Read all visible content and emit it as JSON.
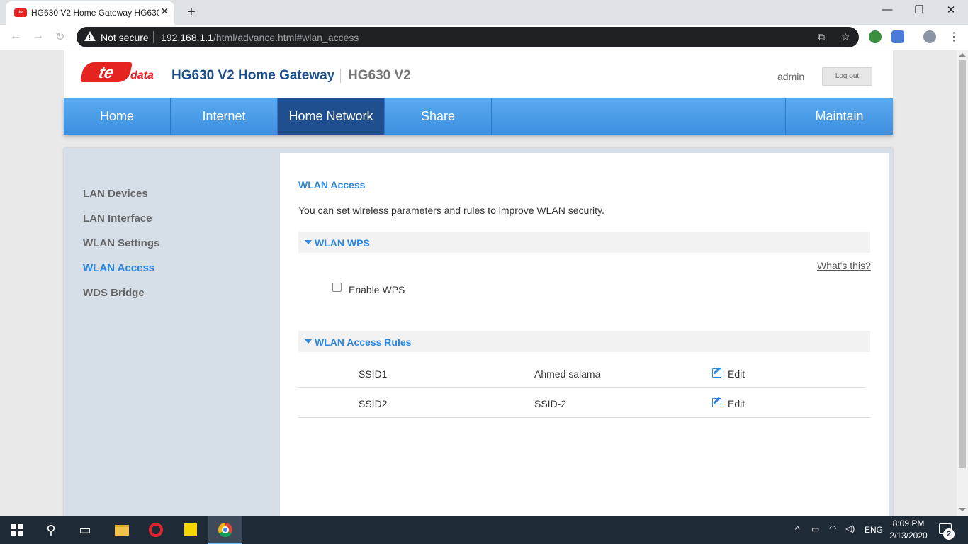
{
  "browser": {
    "tab_title": "HG630 V2 Home Gateway HG630 V2",
    "tab_close": "✕",
    "new_tab": "+",
    "security_label": "Not secure",
    "url_host": "192.168.1.1",
    "url_path": "/html/advance.html#wlan_access",
    "window_controls": {
      "minimize": "—",
      "restore": "❐",
      "close": "✕"
    }
  },
  "header": {
    "logo_main": "te",
    "logo_sub": "data",
    "product_title": "HG630 V2 Home Gateway",
    "model": "HG630 V2",
    "user": "admin",
    "logout_label": "Log out"
  },
  "mainnav": {
    "tabs": [
      {
        "label": "Home"
      },
      {
        "label": "Internet"
      },
      {
        "label": "Home Network"
      },
      {
        "label": "Share"
      },
      {
        "label": "Maintain"
      }
    ]
  },
  "sidebar": {
    "items": [
      {
        "label": "LAN Devices"
      },
      {
        "label": "LAN Interface"
      },
      {
        "label": "WLAN Settings"
      },
      {
        "label": "WLAN Access"
      },
      {
        "label": "WDS Bridge"
      }
    ]
  },
  "main": {
    "title": "WLAN Access",
    "description": "You can set wireless parameters and rules to improve WLAN security.",
    "wps_section": {
      "label": "WLAN WPS",
      "help_link": "What's this?",
      "enable_label": "Enable WPS",
      "enabled": false
    },
    "rules_section": {
      "label": "WLAN Access Rules",
      "rows": [
        {
          "ssid": "SSID1",
          "name": "Ahmed salama",
          "action": "Edit"
        },
        {
          "ssid": "SSID2",
          "name": "SSID-2",
          "action": "Edit"
        }
      ]
    }
  },
  "taskbar": {
    "language": "ENG",
    "time": "8:09 PM",
    "date": "2/13/2020",
    "notifications": "2"
  }
}
